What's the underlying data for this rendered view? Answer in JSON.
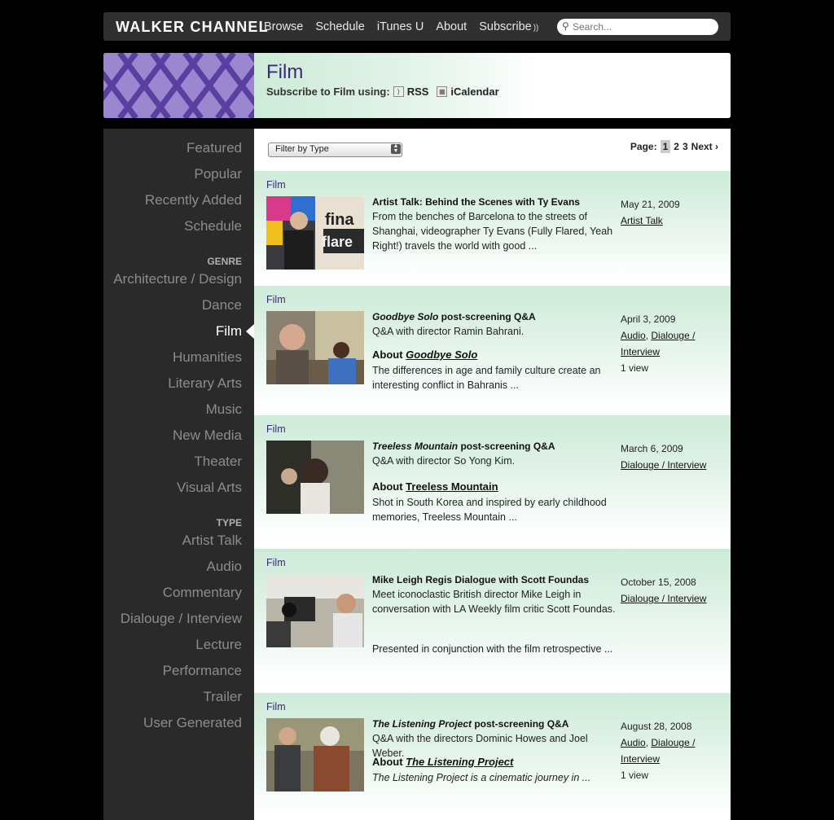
{
  "topnav": {
    "logo": "WALKER CHANNEL",
    "links": [
      "Browse",
      "Schedule",
      "iTunes U",
      "About",
      "Subscribe"
    ],
    "search_placeholder": "Search..."
  },
  "banner": {
    "title": "Film",
    "subscribe_label": "Subscribe to Film using:",
    "rss": "RSS",
    "ical": "iCalendar"
  },
  "sidebar": {
    "browse": [
      "Featured",
      "Popular",
      "Recently Added",
      "Schedule"
    ],
    "genre_head": "GENRE",
    "genres": [
      "Architecture / Design",
      "Dance",
      "Film",
      "Humanities",
      "Literary Arts",
      "Music",
      "New Media",
      "Theater",
      "Visual Arts"
    ],
    "type_head": "TYPE",
    "types": [
      "Artist Talk",
      "Audio",
      "Commentary",
      "Dialouge / Interview",
      "Lecture",
      "Performance",
      "Trailer",
      "User Generated"
    ]
  },
  "filter": {
    "label": "Filter by Type"
  },
  "pager": {
    "label": "Page:",
    "pages": [
      "1",
      "2",
      "3"
    ],
    "next": "Next ›"
  },
  "items": [
    {
      "category": "Film",
      "title": "Artist Talk: Behind the Scenes with Ty Evans",
      "desc": "From the benches of Barcelona to the streets of Shanghai, videographer Ty Evans (Fully Flared, Yeah Right!) travels the world with good ...",
      "date": "May 21, 2009",
      "tags": [
        "Artist Talk"
      ],
      "views": ""
    },
    {
      "category": "Film",
      "title_italic": "Goodbye Solo",
      "title_rest": " post-screening Q&A",
      "desc": "Q&A with director Ramin Bahrani.",
      "about_label": "About",
      "about_link": "Goodbye Solo",
      "desc2": "The differences in age and family culture create an interesting conflict in Bahranis ...",
      "date": "April 3, 2009",
      "tags": [
        "Audio",
        "Dialouge / Interview"
      ],
      "views": "1 view"
    },
    {
      "category": "Film",
      "title_italic": "Treeless Mountain",
      "title_rest": " post-screening Q&A",
      "desc": "Q&A with director So Yong Kim.",
      "about_label": "About",
      "about_link": "Treeless Mountain",
      "desc2": "Shot in South Korea and inspired by early childhood memories, Treeless Mountain ...",
      "date": "March 6, 2009",
      "tags": [
        "Dialouge / Interview"
      ],
      "views": ""
    },
    {
      "category": "Film",
      "title": "Mike Leigh Regis Dialogue with Scott Foundas",
      "desc": "Meet iconoclastic British director Mike Leigh in conversation with LA Weekly film critic Scott Foundas.",
      "desc2": "Presented in conjunction with the film retrospective ...",
      "date": "October 15, 2008",
      "tags": [
        "Dialouge / Interview"
      ],
      "views": ""
    },
    {
      "category": "Film",
      "title_italic": "The Listening Project",
      "title_rest": " post-screening Q&A",
      "desc": "Q&A with the directors Dominic Howes and Joel Weber.",
      "about_label": "About",
      "about_link": "The Listening Project",
      "desc2": "The Listening Project is a cinematic journey in ...",
      "date": "August 28, 2008",
      "tags": [
        "Audio",
        "Dialouge / Interview"
      ],
      "views": "1 view"
    }
  ]
}
